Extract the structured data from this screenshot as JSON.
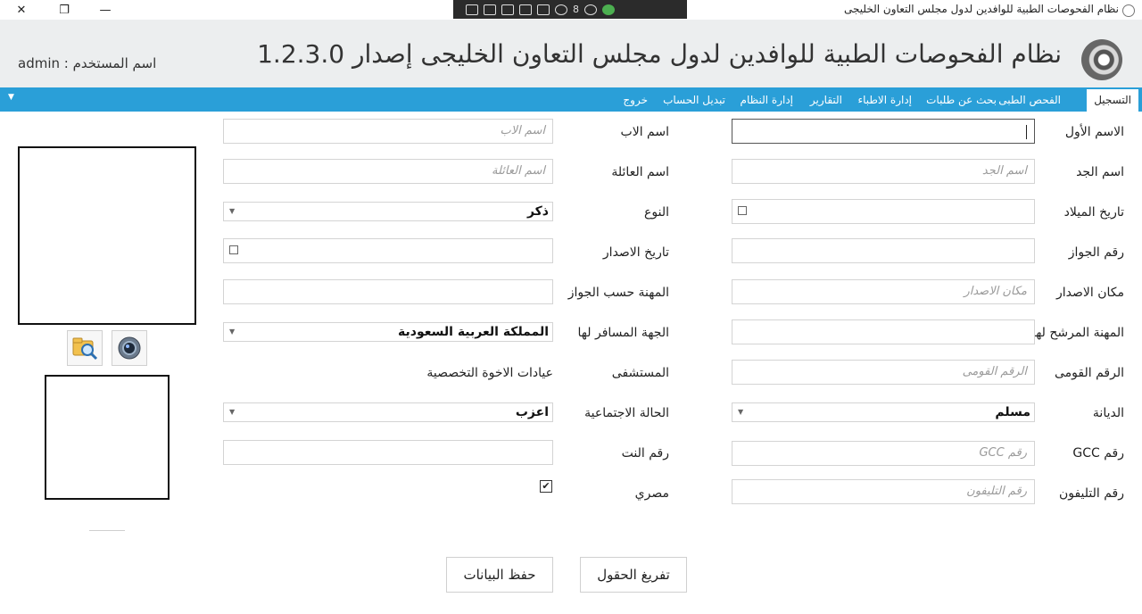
{
  "window": {
    "title": "نظام الفحوصات الطبية للوافدين لدول مجلس التعاون الخليجى",
    "close_glyph": "✕",
    "restore_glyph": "❐",
    "minimize_glyph": "—"
  },
  "toolstrip": {
    "badge_count": "8"
  },
  "header": {
    "app_title": "نظام الفحوصات الطبية للوافدين لدول مجلس التعاون الخليجى إصدار 1.2.3.0",
    "user_label": "اسم المستخدم : admin"
  },
  "menu": {
    "items": [
      "التسجيل",
      "الفحص الطبى",
      "بحث عن طلبات",
      "إدارة الاطباء",
      "التقارير",
      "إدارة النظام",
      "تبديل الحساب",
      "خروج"
    ],
    "collapse_glyph": "▼"
  },
  "form": {
    "first_name": {
      "label": "الاسم الأول",
      "value": "",
      "placeholder": ""
    },
    "father_name": {
      "label": "اسم الاب",
      "placeholder": "اسم الاب"
    },
    "grandfather_name": {
      "label": "اسم الجد",
      "placeholder": "اسم الجد"
    },
    "family_name": {
      "label": "اسم العائلة",
      "placeholder": "اسم العائلة"
    },
    "birth_date": {
      "label": "تاريخ الميلاد"
    },
    "gender": {
      "label": "النوع",
      "value": "ذكر"
    },
    "passport_no": {
      "label": "رقم الجواز"
    },
    "issue_date": {
      "label": "تاريخ الاصدار"
    },
    "issue_place": {
      "label": "مكان الاصدار",
      "placeholder": "مكان الاصدار"
    },
    "passport_profession": {
      "label": "المهنة حسب الجواز"
    },
    "nominated_profession": {
      "label": "المهنة المرشح لها"
    },
    "destination": {
      "label": "الجهة المسافر لها",
      "value": "المملكة العربية السعودية"
    },
    "national_id": {
      "label": "الرقم القومى",
      "placeholder": "الرقم القومى"
    },
    "hospital": {
      "label": "المستشفى",
      "value": "عيادات الاخوة التخصصية"
    },
    "religion": {
      "label": "الديانة",
      "value": "مسلم"
    },
    "marital_status": {
      "label": "الحالة الاجتماعية",
      "value": "اعزب"
    },
    "gcc_no": {
      "label": "رقم GCC",
      "placeholder": "رقم GCC"
    },
    "net_no": {
      "label": "رقم النت"
    },
    "phone": {
      "label": "رقم التليفون",
      "placeholder": "رقم التليفون"
    },
    "egyptian": {
      "label": "مصري",
      "checked": true,
      "check_glyph": "✔"
    }
  },
  "buttons": {
    "clear": "تفريغ الحقول",
    "save": "حفظ البيانات"
  }
}
